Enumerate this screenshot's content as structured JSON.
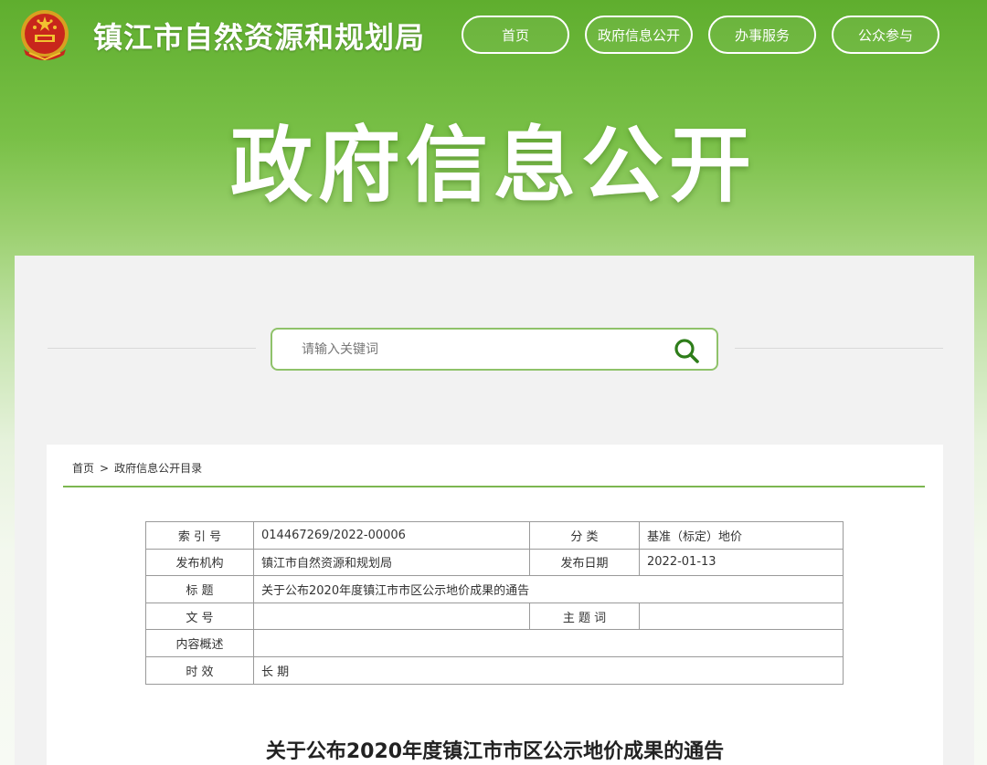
{
  "header": {
    "site_title": "镇江市自然资源和规划局",
    "nav": [
      {
        "label": "首页"
      },
      {
        "label": "政府信息公开"
      },
      {
        "label": "办事服务"
      },
      {
        "label": "公众参与"
      }
    ]
  },
  "hero": {
    "title": "政府信息公开"
  },
  "search": {
    "placeholder": "请输入关键词",
    "icon": "search-icon"
  },
  "breadcrumb": {
    "home": "首页",
    "separator": ">",
    "current": "政府信息公开目录"
  },
  "meta_table": {
    "index_label": "索 引 号",
    "index_value": "014467269/2022-00006",
    "category_label": "分    类",
    "category_value": "基准（标定）地价",
    "publisher_label": "发布机构",
    "publisher_value": "镇江市自然资源和规划局",
    "date_label": "发布日期",
    "date_value": "2022-01-13",
    "title_label": "标    题",
    "title_value": "关于公布2020年度镇江市市区公示地价成果的通告",
    "docno_label": "文    号",
    "docno_value": "",
    "keywords_label": "主 题 词",
    "keywords_value": "",
    "summary_label": "内容概述",
    "summary_value": "",
    "validity_label": "时    效",
    "validity_value": "长 期"
  },
  "article": {
    "title": "关于公布2020年度镇江市市区公示地价成果的通告"
  },
  "colors": {
    "accent": "#7cb650",
    "banner_green": "#6db53a"
  }
}
